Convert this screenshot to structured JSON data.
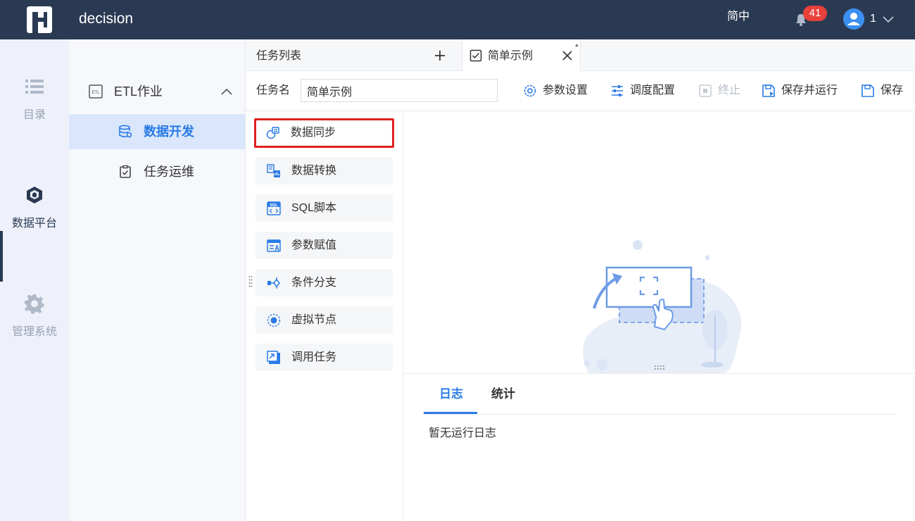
{
  "header": {
    "app_title": "decision",
    "language": "简中",
    "notification_count": "41",
    "user_name": "1"
  },
  "rail": {
    "items": [
      {
        "label": "目录",
        "icon": "list-icon"
      },
      {
        "label": "数据平台",
        "icon": "cube-icon"
      },
      {
        "label": "管理系统",
        "icon": "gear-icon"
      }
    ]
  },
  "nav": {
    "group_label": "ETL作业",
    "items": [
      {
        "label": "数据开发",
        "icon": "database-icon",
        "active": true
      },
      {
        "label": "任务运维",
        "icon": "clipboard-check-icon",
        "active": false
      }
    ]
  },
  "tabs": {
    "list_label": "任务列表",
    "active_tab_label": "简单示例",
    "unsaved_marker": "*"
  },
  "toolbar": {
    "name_label": "任务名",
    "name_value": "简单示例",
    "buttons": [
      {
        "label": "参数设置",
        "icon": "settings-icon"
      },
      {
        "label": "调度配置",
        "icon": "sliders-icon"
      },
      {
        "label": "终止",
        "icon": "stop-icon",
        "disabled": true
      },
      {
        "label": "保存并运行",
        "icon": "save-run-icon"
      },
      {
        "label": "保存",
        "icon": "save-icon"
      }
    ]
  },
  "palette": {
    "items": [
      {
        "label": "数据同步",
        "icon": "data-sync-icon",
        "selected": true
      },
      {
        "label": "数据转换",
        "icon": "data-transform-icon"
      },
      {
        "label": "SQL脚本",
        "icon": "sql-script-icon"
      },
      {
        "label": "参数赋值",
        "icon": "param-assign-icon"
      },
      {
        "label": "条件分支",
        "icon": "condition-branch-icon"
      },
      {
        "label": "虚拟节点",
        "icon": "virtual-node-icon"
      },
      {
        "label": "调用任务",
        "icon": "call-task-icon"
      }
    ]
  },
  "log_panel": {
    "tabs": [
      {
        "label": "日志",
        "active": true
      },
      {
        "label": "统计",
        "active": false
      }
    ],
    "empty_message": "暂无运行日志"
  },
  "colors": {
    "topbar": "#2b3a53",
    "accent": "#2a7be6",
    "highlight_border": "#e02020",
    "badge": "#e8403a"
  }
}
